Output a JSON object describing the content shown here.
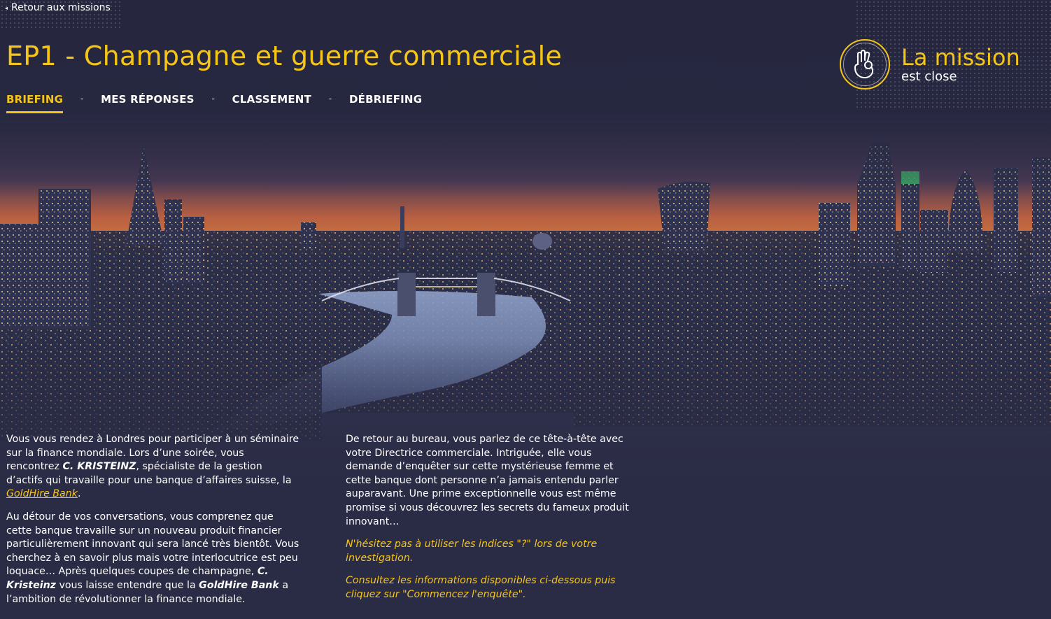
{
  "nav": {
    "back_label": "Retour aux missions"
  },
  "header": {
    "title": "EP1 - Champagne et guerre commerciale"
  },
  "tabs": [
    {
      "label": "BRIEFING",
      "active": true
    },
    {
      "label": "MES RÉPONSES",
      "active": false
    },
    {
      "label": "CLASSEMENT",
      "active": false
    },
    {
      "label": "DÉBRIEFING",
      "active": false
    }
  ],
  "tab_separator": "-",
  "status": {
    "title": "La mission",
    "subtitle": "est close",
    "icon": "ok-hand-icon"
  },
  "briefing": {
    "left": {
      "p1": {
        "t1": "Vous vous rendez à Londres pour participer à un séminaire sur la finance mondiale. Lors d’une soirée, vous rencontrez ",
        "name": "C. KRISTEINZ",
        "t2": ", spécialiste de la gestion d’actifs qui travaille pour une banque d’affaires suisse, la ",
        "link": "GoldHire Bank",
        "t3": "."
      },
      "p2": {
        "t1": "Au détour de vos conversations, vous comprenez que cette banque travaille sur un nouveau produit financier particulièrement innovant qui sera lancé très bientôt. Vous cherchez à en savoir plus mais votre interlocutrice est peu loquace… Après quelques coupes de champagne, ",
        "name": "C. Kristeinz",
        "t2": " vous laisse entendre que la ",
        "bank": "GoldHire Bank",
        "t3": " a l’ambition de révolutionner la finance mondiale."
      }
    },
    "right": {
      "p1": "De retour au bureau, vous parlez de ce tête-à-tête avec votre Directrice commerciale. Intriguée, elle vous demande d’enquêter sur cette mystérieuse femme et cette banque dont personne n’a jamais entendu parler auparavant. Une prime exceptionnelle vous est même promise si vous découvrez les secrets du fameux produit innovant…",
      "hint1": "N'hésitez pas à utiliser les indices \"?\" lors de votre investigation.",
      "hint2": "Consultez les informations disponibles ci-dessous puis cliquez sur \"Commencez l'enquête\"."
    }
  },
  "colors": {
    "accent": "#f5c518",
    "background": "#2a2b45",
    "sky_glow": "#c7603e"
  }
}
